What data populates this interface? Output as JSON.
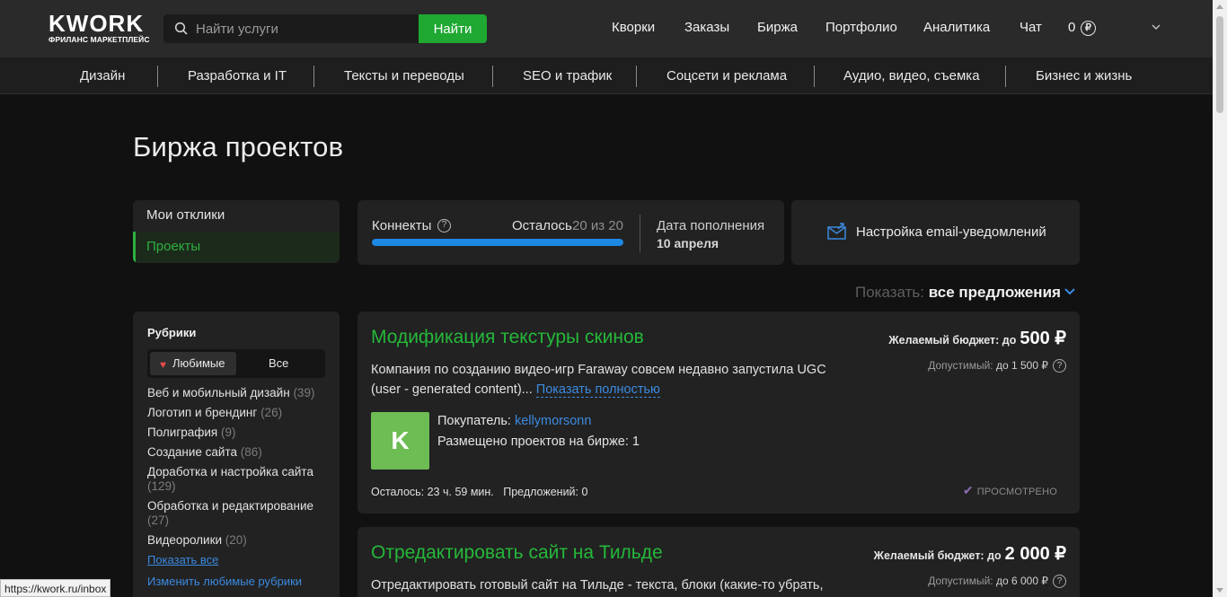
{
  "header": {
    "logo_word": "KWORK",
    "logo_sub": "ФРИЛАНС МАРКЕТПЛЕЙС",
    "search_placeholder": "Найти услуги",
    "search_button": "Найти",
    "nav": [
      "Кворки",
      "Заказы",
      "Биржа",
      "Портфолио",
      "Аналитика",
      "Чат"
    ],
    "balance": "0",
    "currency_symbol": "₽"
  },
  "categories": [
    "Дизайн",
    "Разработка и IT",
    "Тексты и переводы",
    "SEO и трафик",
    "Соцсети и реклама",
    "Аудио, видео, съемка",
    "Бизнес и жизнь"
  ],
  "page_title": "Биржа проектов",
  "left_menu": [
    "Мои отклики",
    "Проекты"
  ],
  "connects": {
    "label": "Коннекты",
    "help": "?",
    "left_label": "Осталось",
    "count": "20 из 20",
    "progress": 1.0,
    "refill_label": "Дата пополнения",
    "refill_date": "10 апреля"
  },
  "email_settings": "Настройка email-уведомлений",
  "filter": {
    "prefix": "Показать:",
    "value": "все предложения"
  },
  "rubrics": {
    "title": "Рубрики",
    "tab_fav": "Любимые",
    "tab_all": "Все",
    "items": [
      {
        "name": "Веб и мобильный дизайн",
        "count": "(39)"
      },
      {
        "name": "Логотип и брендинг",
        "count": "(26)"
      },
      {
        "name": "Полиграфия",
        "count": "(9)"
      },
      {
        "name": "Создание сайта",
        "count": "(86)"
      },
      {
        "name": "Доработка и настройка сайта",
        "count": "(129)"
      },
      {
        "name": "Обработка и редактирование",
        "count": "(27)"
      },
      {
        "name": "Видеоролики",
        "count": "(20)"
      }
    ],
    "show_all": "Показать все",
    "edit_fav": "Изменить любимые рубрики"
  },
  "projects": [
    {
      "title": "Модификация текстуры скинов",
      "budget_label": "Желаемый бюджет: до",
      "budget": "500 ₽",
      "allowed_label": "Допустимый:",
      "allowed": "до 1 500 ₽",
      "description": "Компания по созданию видео-игр Faraway совсем недавно запустила UGC (user - generated content)...",
      "more": "Показать полностью",
      "avatar_letter": "K",
      "buyer_label": "Покупатель:",
      "buyer": "kellymorsonn",
      "placed": "Размещено проектов на бирже: 1",
      "time_left": "Осталось: 23 ч. 59 мин.",
      "offers": "Предложений: 0",
      "status": "ПРОСМОТРЕНО"
    },
    {
      "title": "Отредактировать сайт на Тильде",
      "budget_label": "Желаемый бюджет: до",
      "budget": "2 000 ₽",
      "allowed_label": "Допустимый:",
      "allowed": "до 6 000 ₽",
      "description": "Отредактировать готовый сайт на Тильде - текста, блоки (какие-то убрать,"
    }
  ],
  "status_url": "https://kwork.ru/inbox"
}
